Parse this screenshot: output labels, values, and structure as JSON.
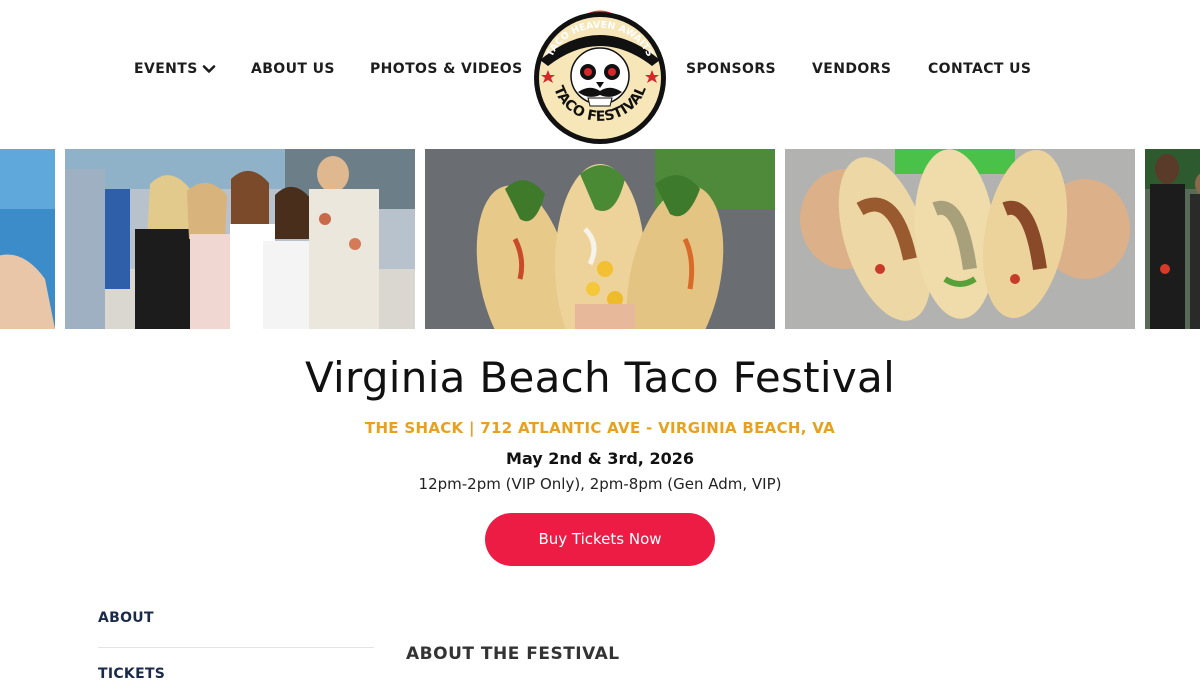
{
  "nav": {
    "events": "EVENTS",
    "about_us": "ABOUT US",
    "photos_videos": "PHOTOS & VIDEOS",
    "sponsors": "SPONSORS",
    "vendors": "VENDORS",
    "contact_us": "CONTACT US"
  },
  "logo": {
    "top_text": "TACO HEAVEN AWAITS",
    "bottom_text": "TACO FESTIVAL"
  },
  "hero": {
    "title": "Virginia Beach Taco Festival",
    "venue": "THE SHACK | 712 ATLANTIC AVE - VIRGINIA BEACH, VA",
    "date": "May 2nd & 3rd, 2026",
    "hours": "12pm-2pm (VIP Only), 2pm-8pm (Gen Adm, VIP)",
    "cta_label": "Buy Tickets Now"
  },
  "sidebar": {
    "items": [
      {
        "label": "ABOUT"
      },
      {
        "label": "TICKETS"
      }
    ]
  },
  "main": {
    "section_heading": "ABOUT THE FESTIVAL"
  },
  "colors": {
    "accent_red": "#ec1c45",
    "venue_orange": "#e8a020",
    "sidebar_navy": "#1a2a4a"
  },
  "icons": {
    "events_dropdown": "chevron-down-icon"
  }
}
